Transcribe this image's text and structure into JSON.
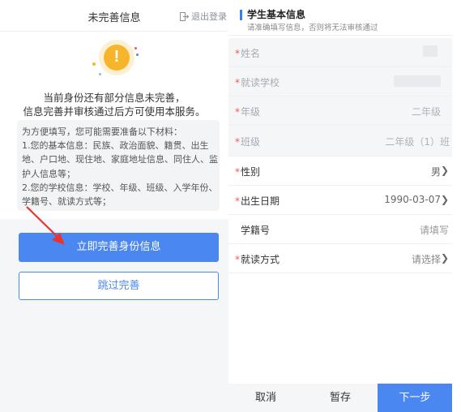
{
  "left": {
    "title": "未完善信息",
    "logout": "退出登录",
    "message_line1": "当前身份还有部分信息未完善，",
    "message_line2": "信息完善并审核通过后方可使用本服务。",
    "materials": [
      "为方便填写，您可能需要准备以下材料：",
      "1.您的基本信息：民族、政治面貌、籍贯、出生",
      "地、户口地、现住地、家庭地址信息、同住人、监",
      "护人信息等；",
      "2.您的学校信息：学校、年级、班级、入学年份、",
      "学籍号、就读方式等；"
    ],
    "primary_button": "立即完善身份信息",
    "skip_button": "跳过完善"
  },
  "right": {
    "header_title": "学生基本信息",
    "header_subtitle": "请准确填写信息，否则将无法审核通过",
    "fields": [
      {
        "label": "姓名",
        "required": "*",
        "value": ""
      },
      {
        "label": "就读学校",
        "required": "*",
        "value": ""
      },
      {
        "label": "年级",
        "required": "*",
        "value": "二年级"
      },
      {
        "label": "班级",
        "required": "*",
        "value": "二年级（1）班"
      },
      {
        "label": "性别",
        "required": "*",
        "value": "男"
      },
      {
        "label": "出生日期",
        "required": "*",
        "value": "1990-03-07"
      },
      {
        "label": "学籍号",
        "required": "",
        "value": "请填写"
      },
      {
        "label": "就读方式",
        "required": "*",
        "value": "请选择"
      }
    ],
    "footer": {
      "cancel": "取消",
      "save": "暂存",
      "next": "下一步"
    }
  },
  "colors": {
    "primary": "#4b87f0",
    "warning": "#f7b52c",
    "required": "#f05a4f",
    "annotation_arrow": "#e8332e"
  },
  "icons": {
    "logout": "logout-icon",
    "alert": "exclamation-icon",
    "chevron": "chevron-right-icon"
  }
}
